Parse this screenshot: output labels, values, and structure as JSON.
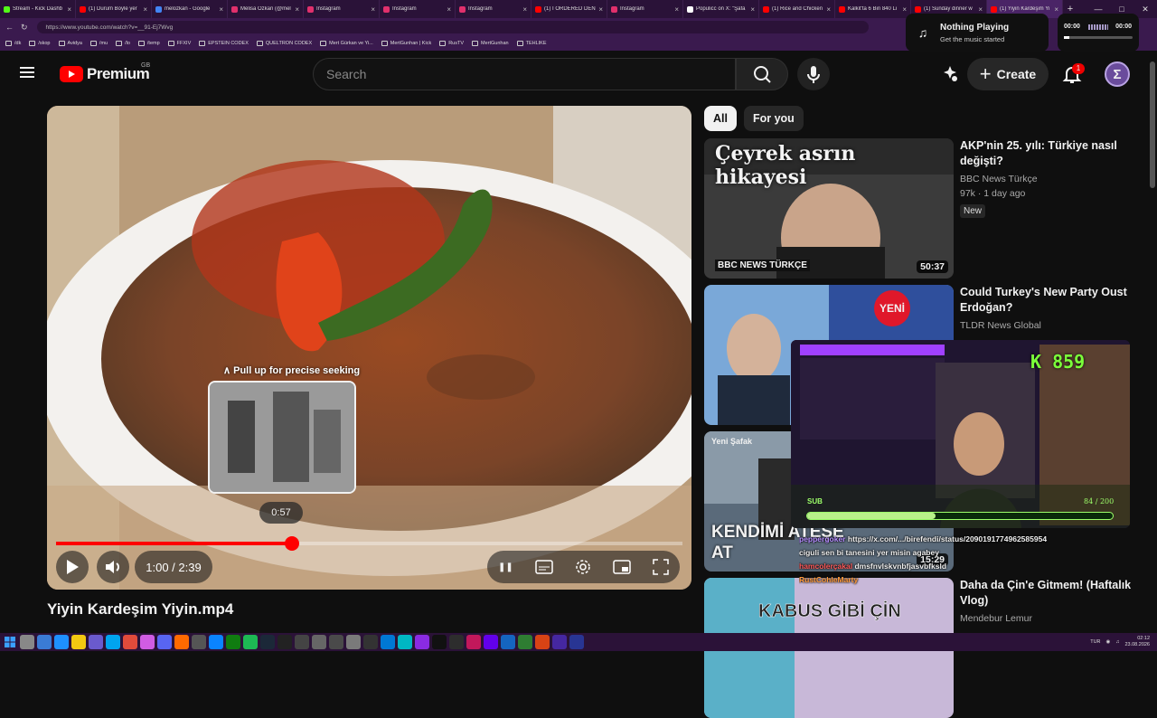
{
  "browser": {
    "tabs": [
      {
        "title": "Stream - Kick Dashb",
        "color": "#53fc18"
      },
      {
        "title": "(1) Durum Boyle yer",
        "color": "#ff0000"
      },
      {
        "title": "melozkan - Google",
        "color": "#4285f4"
      },
      {
        "title": "Melisa Ozkan (@mel",
        "color": "#e1306c"
      },
      {
        "title": "Instagram",
        "color": "#e1306c"
      },
      {
        "title": "Instagram",
        "color": "#e1306c"
      },
      {
        "title": "Instagram",
        "color": "#e1306c"
      },
      {
        "title": "(1) I ORDERED DENI",
        "color": "#ff0000"
      },
      {
        "title": "Instagram",
        "color": "#e1306c"
      },
      {
        "title": "Populicc on X: \"Şafa",
        "color": "#ffffff"
      },
      {
        "title": "(1) Rice and Chicken",
        "color": "#ff0000"
      },
      {
        "title": "Kalkit'ta 6 Bin 840 Li",
        "color": "#ff0000"
      },
      {
        "title": "(1) Sunday dinner w",
        "color": "#ff0000"
      },
      {
        "title": "(1) Yiyin Kardeşim Yi",
        "color": "#ff0000",
        "active": true
      }
    ],
    "url": "https://www.youtube.com/watch?v=__91-Ej7Wvg",
    "bookmarks": [
      "/dk",
      "/skop",
      "Avidya",
      "/mu",
      "/lo",
      "/temp",
      "FFXIV",
      "EPSTEIN CODEX",
      "QUELTRON CODEX",
      "Mert Gürkan ve Yi...",
      "MertGunhan | Kick",
      "RusTV",
      "MertGunhan",
      "TEHLIKE"
    ]
  },
  "header": {
    "logo_text": "Premium",
    "country": "GB",
    "search_placeholder": "Search",
    "create_label": "Create",
    "notification_count": "1",
    "avatar_letter": "Σ"
  },
  "now_playing": {
    "title": "Nothing Playing",
    "subtitle": "Get the music started",
    "time_start": "00:00",
    "time_end": "00:00"
  },
  "player": {
    "seek_hint": "∧ Pull up for precise seeking",
    "preview_time": "0:57",
    "time_readout": "1:00 / 2:39",
    "progress": 0.376,
    "title": "Yiyin Kardeşim Yiyin.mp4"
  },
  "filters": [
    "All",
    "For you"
  ],
  "recommendations": [
    {
      "title": "AKP'nin 25. yılı: Türkiye nasıl değişti?",
      "channel": "BBC News Türkçe",
      "meta": "97k · 1 day ago",
      "badge": "New",
      "duration": "50:37",
      "thumb_text": "Çeyrek asrın hikayesi",
      "thumb_label": "BBC NEWS TÜRKÇE"
    },
    {
      "title": "Could Turkey's New Party Oust Erdoğan?",
      "channel": "TLDR News Global",
      "thumb_text": "YENİ"
    },
    {
      "title": "",
      "channel": "",
      "duration": "15:29",
      "thumb_text": "KENDİMİ ATEŞE AT",
      "thumb_label": "Yeni Şafak"
    },
    {
      "title": "Daha da Çin'e Gitmem! (Haftalık Vlog)",
      "channel": "Mendebur Lemur",
      "thumb_text": "KABUS GİBİ ÇİN"
    }
  ],
  "overlay": {
    "counter": "K 859",
    "sub_label": "SUB",
    "sub_count": "84 / 200",
    "sub_progress": 0.42,
    "chat": [
      {
        "user": "peppergoker",
        "text": "https://x.com/.../birefendi/status/2090191774962585954",
        "color": "#b58cff"
      },
      {
        "user": "",
        "text": "ciguli sen bi tanesini yer misin agabey",
        "color": "#ffffff"
      },
      {
        "user": "hamcolerçakal",
        "text": "dmsfnvlskvnbfjasvbfksld",
        "color": "#ff5a5a"
      },
      {
        "user": "RustCohleMarty",
        "text": "",
        "color": "#ff9a3a"
      }
    ]
  },
  "taskbar": {
    "lang": "TUR",
    "time": "02:12",
    "date": "23.08.2026"
  },
  "colors": {
    "brand_red": "#ff0000",
    "bg": "#0f0f0f",
    "chrome": "#2a1238",
    "accent_green": "#7bff3a"
  }
}
